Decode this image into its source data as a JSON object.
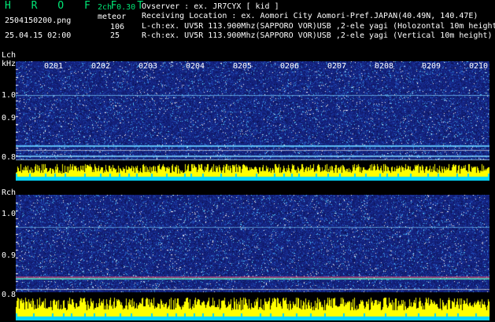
{
  "header": {
    "title": "H R O F F T",
    "version": "2ch 0.30",
    "filename": "2504150200.png",
    "timestamp": "25.04.15 02:00",
    "meteor_label": "meteor",
    "lch_count": "106",
    "rch_count": "25",
    "observer": "Ovserver                : ex. JR7CYX [ kid ]",
    "location": "Receiving Location : ex. Aomori City Aomori-Pref.JAPAN(40.49N, 140.47E)",
    "lch_desc": "L-ch:ex. UV5R 113.900Mhz(SAPPORO VOR)USB ,2-ele yagi (Holozontal 10m height)",
    "rch_desc": "R-ch:ex. UV5R 113.900Mhz(SAPPORO VOR)USB ,2-ele yagi (Vertical 10m height)"
  },
  "lch": {
    "label": "Lch",
    "unit": "kHz",
    "y_labels": [
      "1.0",
      "0.9",
      "0.8"
    ]
  },
  "rch": {
    "label": "Rch",
    "y_labels": [
      "1.0",
      "0.9",
      "0.8"
    ]
  },
  "time_labels": [
    "0201",
    "0202",
    "0203",
    "0204",
    "0205",
    "0206",
    "0207",
    "0208",
    "0209",
    "0210"
  ],
  "colors": {
    "background": "#000000",
    "spectrum": "#1a2a9a",
    "amplitude": "#ffff00",
    "floor": "#00e5ff",
    "title": "#00e676"
  }
}
